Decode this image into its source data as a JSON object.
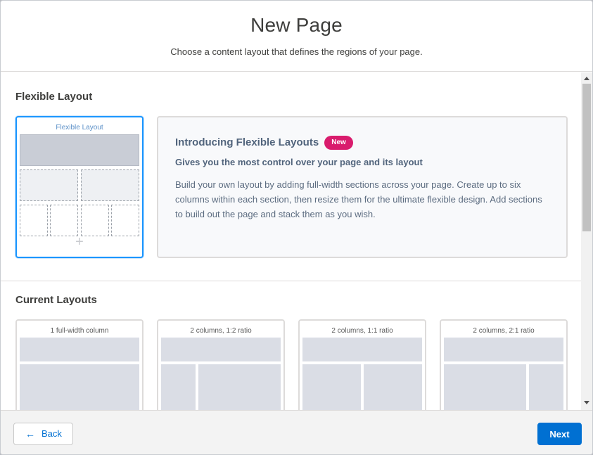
{
  "header": {
    "title": "New Page",
    "subtitle": "Choose a content layout that defines the regions of your page."
  },
  "flexible_section": {
    "title": "Flexible Layout",
    "card": {
      "label": "Flexible Layout",
      "add_glyph": "+"
    },
    "intro": {
      "title": "Introducing Flexible Layouts",
      "badge": "New",
      "subtitle": "Gives you the most control over your page and its layout",
      "description": "Build your own layout by adding full-width sections across your page. Create up to six columns within each section, then resize them for the ultimate flexible design. Add sections to build out the page and stack them as you wish."
    }
  },
  "current_section": {
    "title": "Current Layouts",
    "layouts": [
      {
        "label": "1 full-width column"
      },
      {
        "label": "2 columns, 1:2 ratio"
      },
      {
        "label": "2 columns, 1:1 ratio"
      },
      {
        "label": "2 columns, 2:1 ratio"
      }
    ]
  },
  "footer": {
    "back_label": "Back",
    "back_icon": "arrow-left-icon",
    "next_label": "Next"
  },
  "colors": {
    "brand": "#0070d2",
    "selected_border": "#1b96ff",
    "badge": "#d91c6d"
  }
}
